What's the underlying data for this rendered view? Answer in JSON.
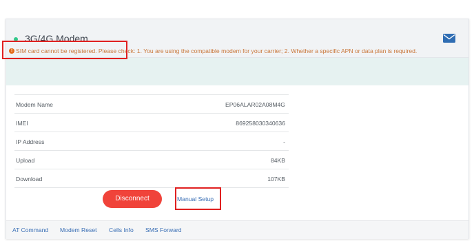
{
  "header": {
    "title": "3G/4G Modem",
    "status_color": "#32c88a",
    "icons": [
      "status-dot",
      "mail-icon"
    ]
  },
  "alert": {
    "text": "SIM card cannot be registered. Please check: 1. You are using the compatible modem for your carrier; 2. Whether a specific APN or data plan is required.",
    "icon": "warning-icon",
    "color": "#c9773a"
  },
  "info_rows": [
    {
      "label": "Modem Name",
      "value": "EP06ALAR02A08M4G"
    },
    {
      "label": "IMEI",
      "value": "869258030340636"
    },
    {
      "label": "IP Address",
      "value": "-"
    },
    {
      "label": "Upload",
      "value": "84KB"
    },
    {
      "label": "Download",
      "value": "107KB"
    }
  ],
  "actions": {
    "disconnect_label": "Disconnect",
    "manual_setup_label": "Manual Setup"
  },
  "footer": {
    "links": [
      "AT Command",
      "Modem Reset",
      "Cells Info",
      "SMS Forward"
    ]
  },
  "colors": {
    "accent_red": "#f0433a",
    "link_blue": "#3a6fb5",
    "highlight_red": "#e02020"
  }
}
